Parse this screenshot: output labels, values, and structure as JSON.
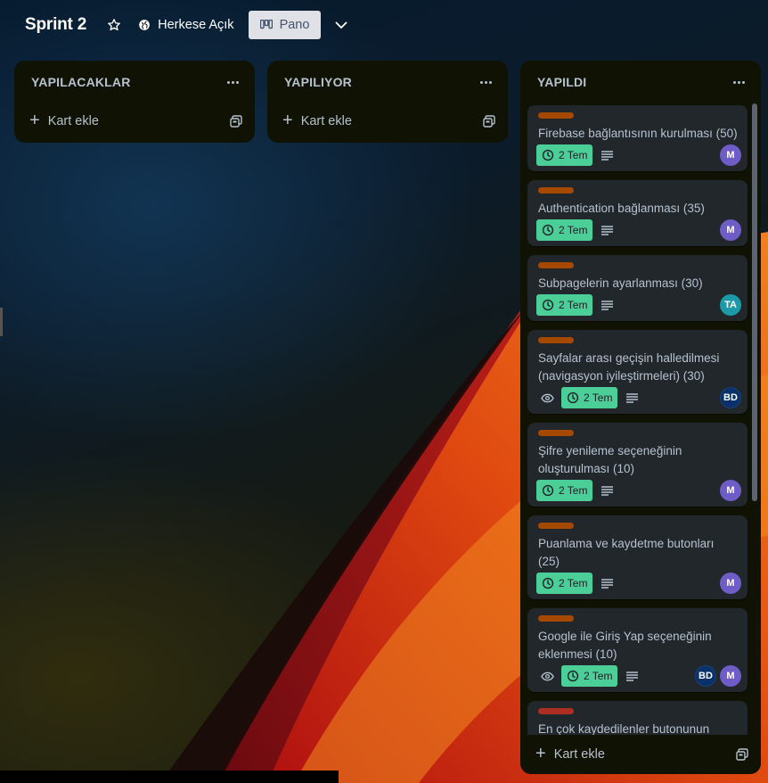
{
  "header": {
    "board_title": "Sprint 2",
    "visibility_label": "Herkese Açık",
    "view_label": "Pano"
  },
  "lists": [
    {
      "title": "YAPILACAKLAR",
      "add_card_label": "Kart ekle"
    },
    {
      "title": "YAPILIYOR",
      "add_card_label": "Kart ekle"
    },
    {
      "title": "YAPILDI",
      "add_card_label": "Kart ekle"
    }
  ],
  "colors": {
    "label_orange": "#a54800",
    "label_red": "#ae2e24",
    "date_badge": "#4bce97",
    "avatar_m": "#6e5dc6",
    "avatar_ta": "#1d9aaa",
    "avatar_bd": "#09326c",
    "list_bg": "#101204",
    "card_bg": "#22272b"
  },
  "cards": [
    {
      "title": "Firebase bağlantısının kurulması (50)",
      "date": "2 Tem",
      "label_color": "#a54800",
      "watching": false,
      "members": [
        {
          "initials": "M",
          "color": "#6e5dc6"
        }
      ]
    },
    {
      "title": "Authentication bağlanması (35)",
      "date": "2 Tem",
      "label_color": "#a54800",
      "watching": false,
      "members": [
        {
          "initials": "M",
          "color": "#6e5dc6"
        }
      ]
    },
    {
      "title": "Subpagelerin ayarlanması (30)",
      "date": "2 Tem",
      "label_color": "#a54800",
      "watching": false,
      "members": [
        {
          "initials": "TA",
          "color": "#1d9aaa"
        }
      ]
    },
    {
      "title": "Sayfalar arası geçişin halledilmesi (navigasyon iyileştirmeleri) (30)",
      "date": "2 Tem",
      "label_color": "#a54800",
      "watching": true,
      "members": [
        {
          "initials": "BD",
          "color": "#09326c"
        }
      ]
    },
    {
      "title": "Şifre yenileme seçeneğinin oluşturulması (10)",
      "date": "2 Tem",
      "label_color": "#a54800",
      "watching": false,
      "members": [
        {
          "initials": "M",
          "color": "#6e5dc6"
        }
      ]
    },
    {
      "title": "Puanlama ve kaydetme butonları (25)",
      "date": "2 Tem",
      "label_color": "#a54800",
      "watching": false,
      "members": [
        {
          "initials": "M",
          "color": "#6e5dc6"
        }
      ]
    },
    {
      "title": "Google ile Giriş Yap seçeneğinin eklenmesi (10)",
      "date": "2 Tem",
      "label_color": "#a54800",
      "watching": true,
      "members": [
        {
          "initials": "BD",
          "color": "#09326c"
        },
        {
          "initials": "M",
          "color": "#6e5dc6"
        }
      ]
    },
    {
      "title": "En çok kaydedilenler butonunun",
      "date": "",
      "label_color": "#ae2e24",
      "watching": false,
      "members": []
    }
  ]
}
